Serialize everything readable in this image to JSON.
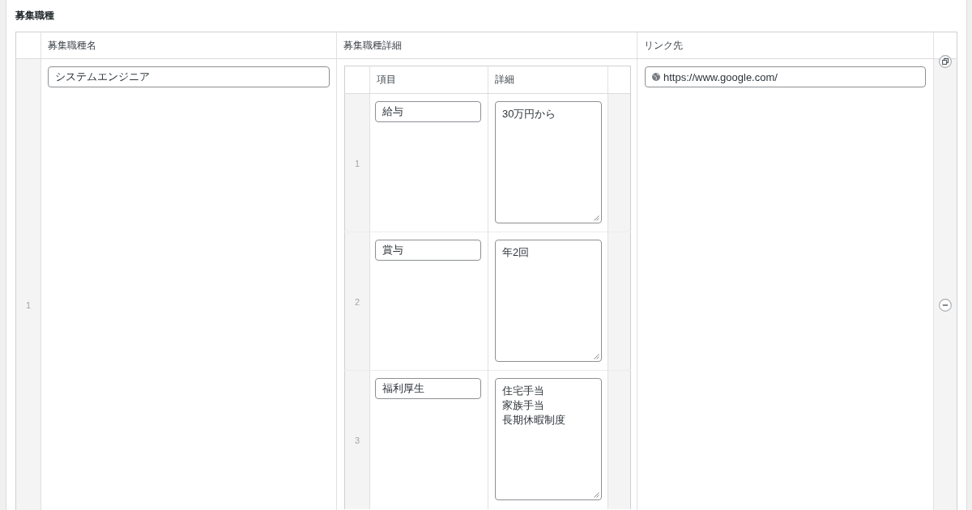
{
  "section": {
    "title": "募集職種"
  },
  "table": {
    "columns": [
      "募集職種名",
      "募集職種詳細",
      "リンク先"
    ],
    "rows": [
      {
        "number": "1",
        "name": "システムエンジニア",
        "link": "https://www.google.com/",
        "details": {
          "columns": [
            "項目",
            "詳細"
          ],
          "rows": [
            {
              "number": "1",
              "item": "給与",
              "detail_lines": [
                "30万円から"
              ]
            },
            {
              "number": "2",
              "item": "賞与",
              "detail_lines": [
                "年2回"
              ]
            },
            {
              "number": "3",
              "item": "福利厚生",
              "detail_lines": [
                "住宅手当",
                "家族手当",
                "長期休暇制度"
              ]
            }
          ]
        }
      }
    ]
  }
}
